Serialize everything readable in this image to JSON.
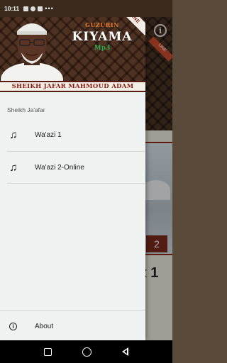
{
  "status_bar": {
    "time": "10:11",
    "dots": "•••"
  },
  "drawer": {
    "header": {
      "ribbon": "OFFLINE",
      "overline": "GUZURIN",
      "title": "KIYAMA",
      "subtitle": "Mp3",
      "speaker": "SHEIKH JAFAR MAHMOUD ADAM"
    },
    "section_label": "Sheikh Ja'afar",
    "items": [
      {
        "label": "Wa'azi 1",
        "icon": "music-note-icon"
      },
      {
        "label": "Wa'azi 2-Online",
        "icon": "music-note-icon"
      }
    ],
    "footer": {
      "label": "About",
      "icon": "info-icon"
    }
  },
  "background": {
    "ribbon": "LINE",
    "badge": "2",
    "text": "t 1",
    "subtext": "-"
  },
  "colors": {
    "header_brown": "#4e3324",
    "title_orange": "#e07a2a",
    "mp3_green": "#2fa84a",
    "name_red": "#8a1d10",
    "drawer_bg": "#eef2f0"
  }
}
